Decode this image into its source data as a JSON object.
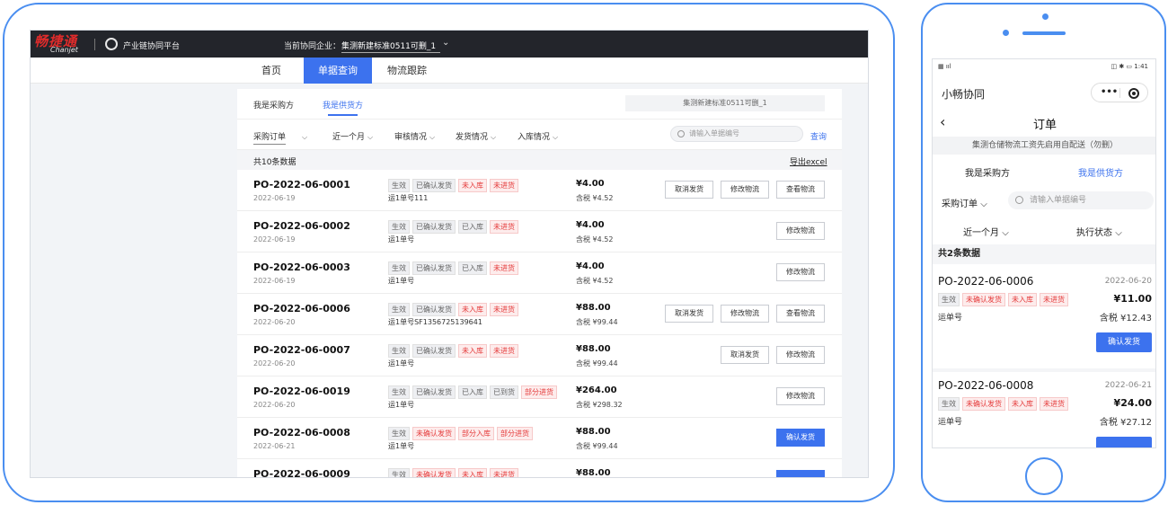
{
  "desktop": {
    "brand": {
      "logo_cn": "畅捷通",
      "logo_en": "Chanjet",
      "platform": "产业链协同平台"
    },
    "enterprise": {
      "label": "当前协同企业：",
      "value": "集测新建标准0511可删_1"
    },
    "nav": [
      "首页",
      "单据查询",
      "物流跟踪"
    ],
    "active_nav": 1,
    "role_tabs": [
      "我是采购方",
      "我是供货方"
    ],
    "enterprise_box": "集测新建标准0511可删_1",
    "filters": {
      "order_type": "采购订单",
      "date": "近一个月",
      "audit": "审核情况",
      "ship": "发货情况",
      "stock": "入库情况"
    },
    "search": {
      "placeholder": "请输入单据编号",
      "button": "查询"
    },
    "count": "共10条数据",
    "export": "导出excel",
    "rows": [
      {
        "po": "PO-2022-06-0001",
        "date": "2022-06-19",
        "tags": [
          {
            "t": "生效",
            "red": false
          },
          {
            "t": "已确认发货",
            "red": false
          },
          {
            "t": "未入库",
            "red": true
          },
          {
            "t": "未进货",
            "red": true
          }
        ],
        "waybill": "运1单号111",
        "price": "¥4.00",
        "tax": "含税 ¥4.52",
        "buttons": [
          {
            "t": "取消发货",
            "p": false
          },
          {
            "t": "修改物流",
            "p": false
          },
          {
            "t": "查看物流",
            "p": false
          }
        ]
      },
      {
        "po": "PO-2022-06-0002",
        "date": "2022-06-19",
        "tags": [
          {
            "t": "生效",
            "red": false
          },
          {
            "t": "已确认发货",
            "red": false
          },
          {
            "t": "已入库",
            "red": false
          },
          {
            "t": "未进货",
            "red": true
          }
        ],
        "waybill": "运1单号",
        "price": "¥4.00",
        "tax": "含税 ¥4.52",
        "buttons": [
          {
            "t": "修改物流",
            "p": false
          }
        ]
      },
      {
        "po": "PO-2022-06-0003",
        "date": "2022-06-19",
        "tags": [
          {
            "t": "生效",
            "red": false
          },
          {
            "t": "已确认发货",
            "red": false
          },
          {
            "t": "已入库",
            "red": false
          },
          {
            "t": "未进货",
            "red": true
          }
        ],
        "waybill": "运1单号",
        "price": "¥4.00",
        "tax": "含税 ¥4.52",
        "buttons": [
          {
            "t": "修改物流",
            "p": false
          }
        ]
      },
      {
        "po": "PO-2022-06-0006",
        "date": "2022-06-20",
        "tags": [
          {
            "t": "生效",
            "red": false
          },
          {
            "t": "已确认发货",
            "red": false
          },
          {
            "t": "未入库",
            "red": true
          },
          {
            "t": "未进货",
            "red": true
          }
        ],
        "waybill": "运1单号SF1356725139641",
        "price": "¥88.00",
        "tax": "含税 ¥99.44",
        "buttons": [
          {
            "t": "取消发货",
            "p": false
          },
          {
            "t": "修改物流",
            "p": false
          },
          {
            "t": "查看物流",
            "p": false
          }
        ]
      },
      {
        "po": "PO-2022-06-0007",
        "date": "2022-06-20",
        "tags": [
          {
            "t": "生效",
            "red": false
          },
          {
            "t": "已确认发货",
            "red": false
          },
          {
            "t": "未入库",
            "red": true
          },
          {
            "t": "未进货",
            "red": true
          }
        ],
        "waybill": "运1单号",
        "price": "¥88.00",
        "tax": "含税 ¥99.44",
        "buttons": [
          {
            "t": "取消发货",
            "p": false
          },
          {
            "t": "修改物流",
            "p": false
          }
        ]
      },
      {
        "po": "PO-2022-06-0019",
        "date": "2022-06-20",
        "tags": [
          {
            "t": "生效",
            "red": false
          },
          {
            "t": "已确认发货",
            "red": false
          },
          {
            "t": "已入库",
            "red": false
          },
          {
            "t": "已到货",
            "red": false
          },
          {
            "t": "部分进货",
            "red": true
          }
        ],
        "waybill": "运1单号",
        "price": "¥264.00",
        "tax": "含税 ¥298.32",
        "buttons": [
          {
            "t": "修改物流",
            "p": false
          }
        ]
      },
      {
        "po": "PO-2022-06-0008",
        "date": "2022-06-21",
        "tags": [
          {
            "t": "生效",
            "red": false
          },
          {
            "t": "未确认发货",
            "red": true
          },
          {
            "t": "部分入库",
            "red": true
          },
          {
            "t": "部分进货",
            "red": true
          }
        ],
        "waybill": "运1单号",
        "price": "¥88.00",
        "tax": "含税 ¥99.44",
        "buttons": [
          {
            "t": "确认发货",
            "p": true
          }
        ]
      },
      {
        "po": "PO-2022-06-0009",
        "date": "",
        "tags": [
          {
            "t": "生效",
            "red": false
          },
          {
            "t": "未确认发货",
            "red": true
          },
          {
            "t": "未入库",
            "red": true
          },
          {
            "t": "未进货",
            "red": true
          }
        ],
        "waybill": "",
        "price": "¥88.00",
        "tax": "",
        "buttons": [
          {
            "t": "",
            "p": true
          }
        ]
      }
    ]
  },
  "phone": {
    "status_left": "▦ ııl",
    "status_right": "◫ ✱ ▭ 1:41",
    "app_title": "小畅协同",
    "capsule_dots": "•••",
    "back": "‹",
    "title": "订单",
    "notice": "集测仓储物流工资先启用自配送（勿删）",
    "tabs": [
      "我是采购方",
      "我是供货方"
    ],
    "order_type": "采购订单",
    "search_placeholder": "请输入单据编号",
    "filter_date": "近一个月",
    "filter_status": "执行状态",
    "count": "共2条数据",
    "cards": [
      {
        "po": "PO-2022-06-0006",
        "date": "2022-06-20",
        "tags": [
          {
            "t": "生效",
            "red": false
          },
          {
            "t": "未确认发货",
            "red": true
          },
          {
            "t": "未入库",
            "red": true
          },
          {
            "t": "未进货",
            "red": true
          }
        ],
        "price": "¥11.00",
        "waybill": "运单号",
        "tax": "含税 ¥12.43",
        "button": "确认发货"
      },
      {
        "po": "PO-2022-06-0008",
        "date": "2022-06-21",
        "tags": [
          {
            "t": "生效",
            "red": false
          },
          {
            "t": "未确认发货",
            "red": true
          },
          {
            "t": "未入库",
            "red": true
          },
          {
            "t": "未进货",
            "red": true
          }
        ],
        "price": "¥24.00",
        "waybill": "运单号",
        "tax": "含税 ¥27.12",
        "button": ""
      }
    ]
  },
  "colors": {
    "accent": "#3c72ee",
    "frame": "#4a8ef0",
    "brand_red": "#e02b2b",
    "tag_red": "#e53b3b",
    "topbar": "#23252b"
  }
}
